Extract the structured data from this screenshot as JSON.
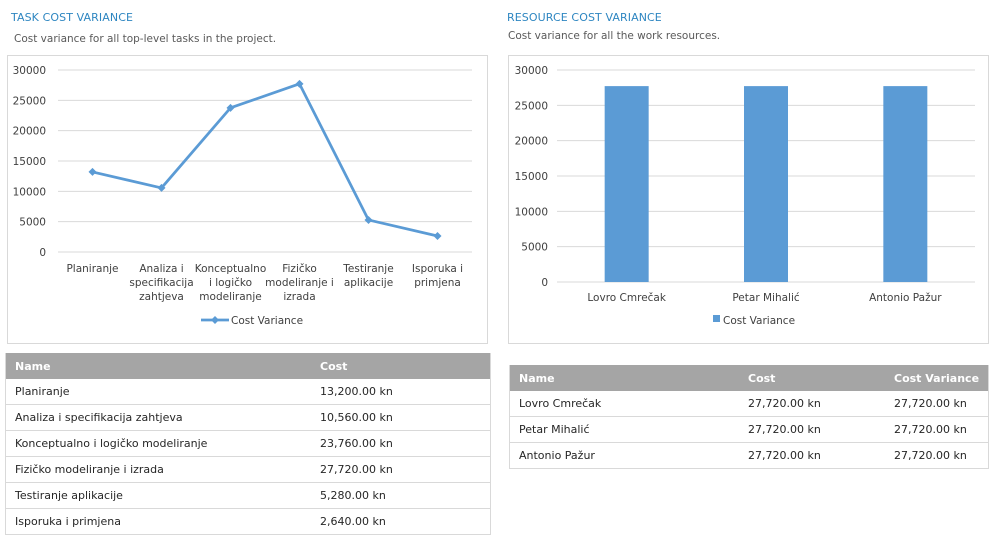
{
  "task_section": {
    "title": "TASK COST VARIANCE",
    "subtitle": "Cost variance for all top-level tasks in the project."
  },
  "resource_section": {
    "title": "RESOURCE COST VARIANCE",
    "subtitle": "Cost variance for all the work resources."
  },
  "chart_data": [
    {
      "type": "line",
      "categories": [
        [
          "Planiranje"
        ],
        [
          "Analiza i",
          "specifikacija",
          "zahtjeva"
        ],
        [
          "Konceptualno",
          "i logičko",
          "modeliranje"
        ],
        [
          "Fizičko",
          "modeliranje i",
          "izrada"
        ],
        [
          "Testiranje",
          "aplikacije"
        ],
        [
          "Isporuka i",
          "primjena"
        ]
      ],
      "series": [
        {
          "name": "Cost Variance",
          "values": [
            13200,
            10560,
            23760,
            27720,
            5280,
            2640
          ]
        }
      ],
      "yticks": [
        "30000",
        "25000",
        "20000",
        "15000",
        "10000",
        "5000",
        "0"
      ],
      "ylim": [
        0,
        30000
      ],
      "grid": true,
      "legend": "bottom",
      "color": "#5b9bd5"
    },
    {
      "type": "bar",
      "categories": [
        "Lovro Cmrečak",
        "Petar Mihalić",
        "Antonio Pažur"
      ],
      "series": [
        {
          "name": "Cost Variance",
          "values": [
            27720,
            27720,
            27720
          ]
        }
      ],
      "yticks": [
        "30000",
        "25000",
        "20000",
        "15000",
        "10000",
        "5000",
        "0"
      ],
      "ylim": [
        0,
        30000
      ],
      "grid": true,
      "legend": "bottom",
      "color": "#5b9bd5"
    }
  ],
  "task_table": {
    "headers": [
      "Name",
      "Cost"
    ],
    "rows": [
      [
        "Planiranje",
        "13,200.00 kn"
      ],
      [
        "Analiza i specifikacija zahtjeva",
        "10,560.00 kn"
      ],
      [
        "Konceptualno i logičko modeliranje",
        "23,760.00 kn"
      ],
      [
        "Fizičko modeliranje i izrada",
        "27,720.00 kn"
      ],
      [
        "Testiranje aplikacije",
        "5,280.00 kn"
      ],
      [
        "Isporuka i primjena",
        "2,640.00 kn"
      ]
    ]
  },
  "resource_table": {
    "headers": [
      "Name",
      "Cost",
      "Cost Variance"
    ],
    "rows": [
      [
        "Lovro Cmrečak",
        "27,720.00 kn",
        "27,720.00 kn"
      ],
      [
        "Petar Mihalić",
        "27,720.00 kn",
        "27,720.00 kn"
      ],
      [
        "Antonio Pažur",
        "27,720.00 kn",
        "27,720.00 kn"
      ]
    ]
  }
}
